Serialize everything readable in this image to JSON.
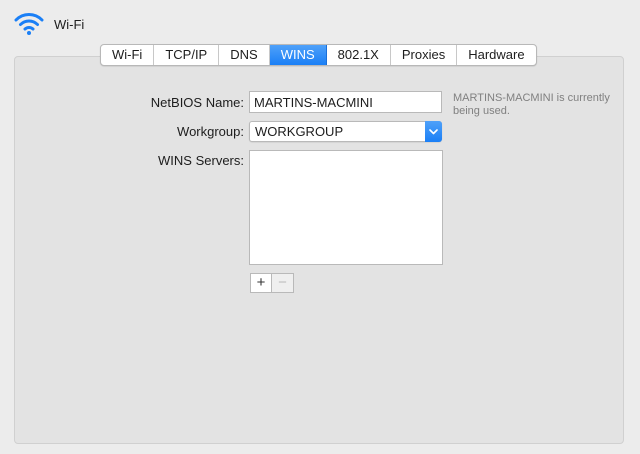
{
  "header": {
    "title": "Wi-Fi",
    "icon": "wifi-icon"
  },
  "tabs": [
    {
      "label": "Wi-Fi",
      "active": false
    },
    {
      "label": "TCP/IP",
      "active": false
    },
    {
      "label": "DNS",
      "active": false
    },
    {
      "label": "WINS",
      "active": true
    },
    {
      "label": "802.1X",
      "active": false
    },
    {
      "label": "Proxies",
      "active": false
    },
    {
      "label": "Hardware",
      "active": false
    }
  ],
  "form": {
    "netbios_label": "NetBIOS Name:",
    "netbios_value": "MARTINS-MACMINI",
    "netbios_hint": "MARTINS-MACMINI is currently being used.",
    "workgroup_label": "Workgroup:",
    "workgroup_value": "WORKGROUP",
    "wins_servers_label": "WINS Servers:",
    "wins_servers": [],
    "add_label": "+",
    "remove_label": "−"
  },
  "colors": {
    "accent": "#1a7ff6",
    "background": "#ececec",
    "panel": "#e3e3e3"
  }
}
